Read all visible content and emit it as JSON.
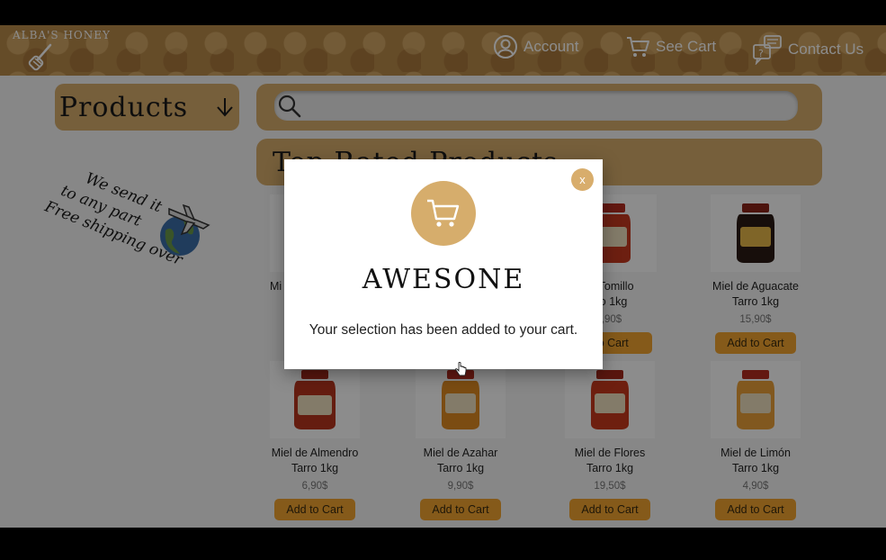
{
  "header": {
    "logo_text": "ALBA'S HONEY",
    "nav": {
      "account": "Account",
      "cart": "See Cart",
      "contact": "Contact Us"
    }
  },
  "sidebar": {
    "products_label": "Products",
    "shipping_lines": [
      "We send it",
      "to any part",
      "Free shipping over"
    ]
  },
  "search": {
    "placeholder": "",
    "value": ""
  },
  "section": {
    "title": "Top Rated Products"
  },
  "products_row1": [
    {
      "name": "Mi",
      "size": "",
      "price": "",
      "add_label": ""
    },
    {
      "name": "",
      "size": "",
      "price": "",
      "add_label": ""
    },
    {
      "name": "e Tomillo",
      "size": "ro 1kg",
      "price": ",90$",
      "add_label": "to Cart"
    },
    {
      "name": "Miel de Aguacate",
      "size": "Tarro 1kg",
      "price": "15,90$",
      "add_label": "Add to Cart"
    }
  ],
  "products_row2": [
    {
      "name": "Miel de Almendro",
      "size": "Tarro 1kg",
      "price": "6,90$",
      "add_label": "Add to Cart",
      "jar_color": "#b8351e",
      "jar_label": "Almendro"
    },
    {
      "name": "Miel de Azahar",
      "size": "Tarro 1kg",
      "price": "9,90$",
      "add_label": "Add to Cart",
      "jar_color": "#e08a22",
      "jar_label": "Azahar"
    },
    {
      "name": "Miel de Flores",
      "size": "Tarro 1kg",
      "price": "19,50$",
      "add_label": "Add to Cart",
      "jar_color": "#c93a1c",
      "jar_label": "Mil Flores"
    },
    {
      "name": "Miel de Limón",
      "size": "Tarro 1kg",
      "price": "4,90$",
      "add_label": "Add to Cart",
      "jar_color": "#eba13a",
      "jar_label": "Limón"
    }
  ],
  "modal": {
    "close_label": "x",
    "title": "AWESONE",
    "message": "Your selection has been added to your cart."
  },
  "colors": {
    "brand_tan": "#d8ad6c",
    "button_orange": "#f2a530",
    "header_brown": "#b98a4a"
  },
  "icons": [
    "honey-dipper-icon",
    "account-icon",
    "cart-icon",
    "contact-chat-icon",
    "chevron-down-icon",
    "search-icon",
    "airplane-icon",
    "globe-icon",
    "jar-icon",
    "close-icon",
    "pointer-cursor-icon"
  ]
}
